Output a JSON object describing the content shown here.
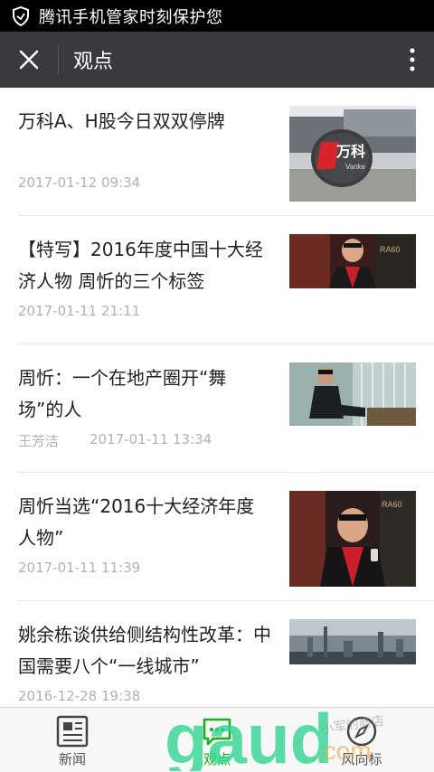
{
  "status_bar": {
    "text": "腾讯手机管家时刻保护您"
  },
  "header": {
    "title": "观点"
  },
  "articles": [
    {
      "title": "万科A、H股今日双双停牌",
      "date": "2017-01-12 09:34",
      "author": "",
      "thumb_logo": "万科",
      "thumb_logo_en": "Vanke"
    },
    {
      "title": "【特写】2016年度中国十大经济人物 周忻的三个标签",
      "date": "2017-01-11 21:11",
      "author": ""
    },
    {
      "title": "周忻：一个在地产圈开“舞场”的人",
      "date": "2017-01-11 13:34",
      "author": "王芳洁"
    },
    {
      "title": "周忻当选“2016十大经济年度人物”",
      "date": "2017-01-11 11:39",
      "author": ""
    },
    {
      "title": "姚余栋谈供给侧结构性改革：中国需要八个“一线城市”",
      "date": "2016-12-28 19:38",
      "author": ""
    }
  ],
  "tabs": [
    {
      "label": "新闻",
      "icon": "newspaper-icon"
    },
    {
      "label": "观点",
      "icon": "chat-bubble-icon",
      "active": true
    },
    {
      "label": "风向标",
      "icon": "compass-icon"
    }
  ],
  "watermark": {
    "text": "gaud.com",
    "handwritten": "小军的商店"
  },
  "colors": {
    "titlebar": "#393a3f",
    "active_tab": "#1aad19",
    "watermark": "#2dd38e"
  }
}
